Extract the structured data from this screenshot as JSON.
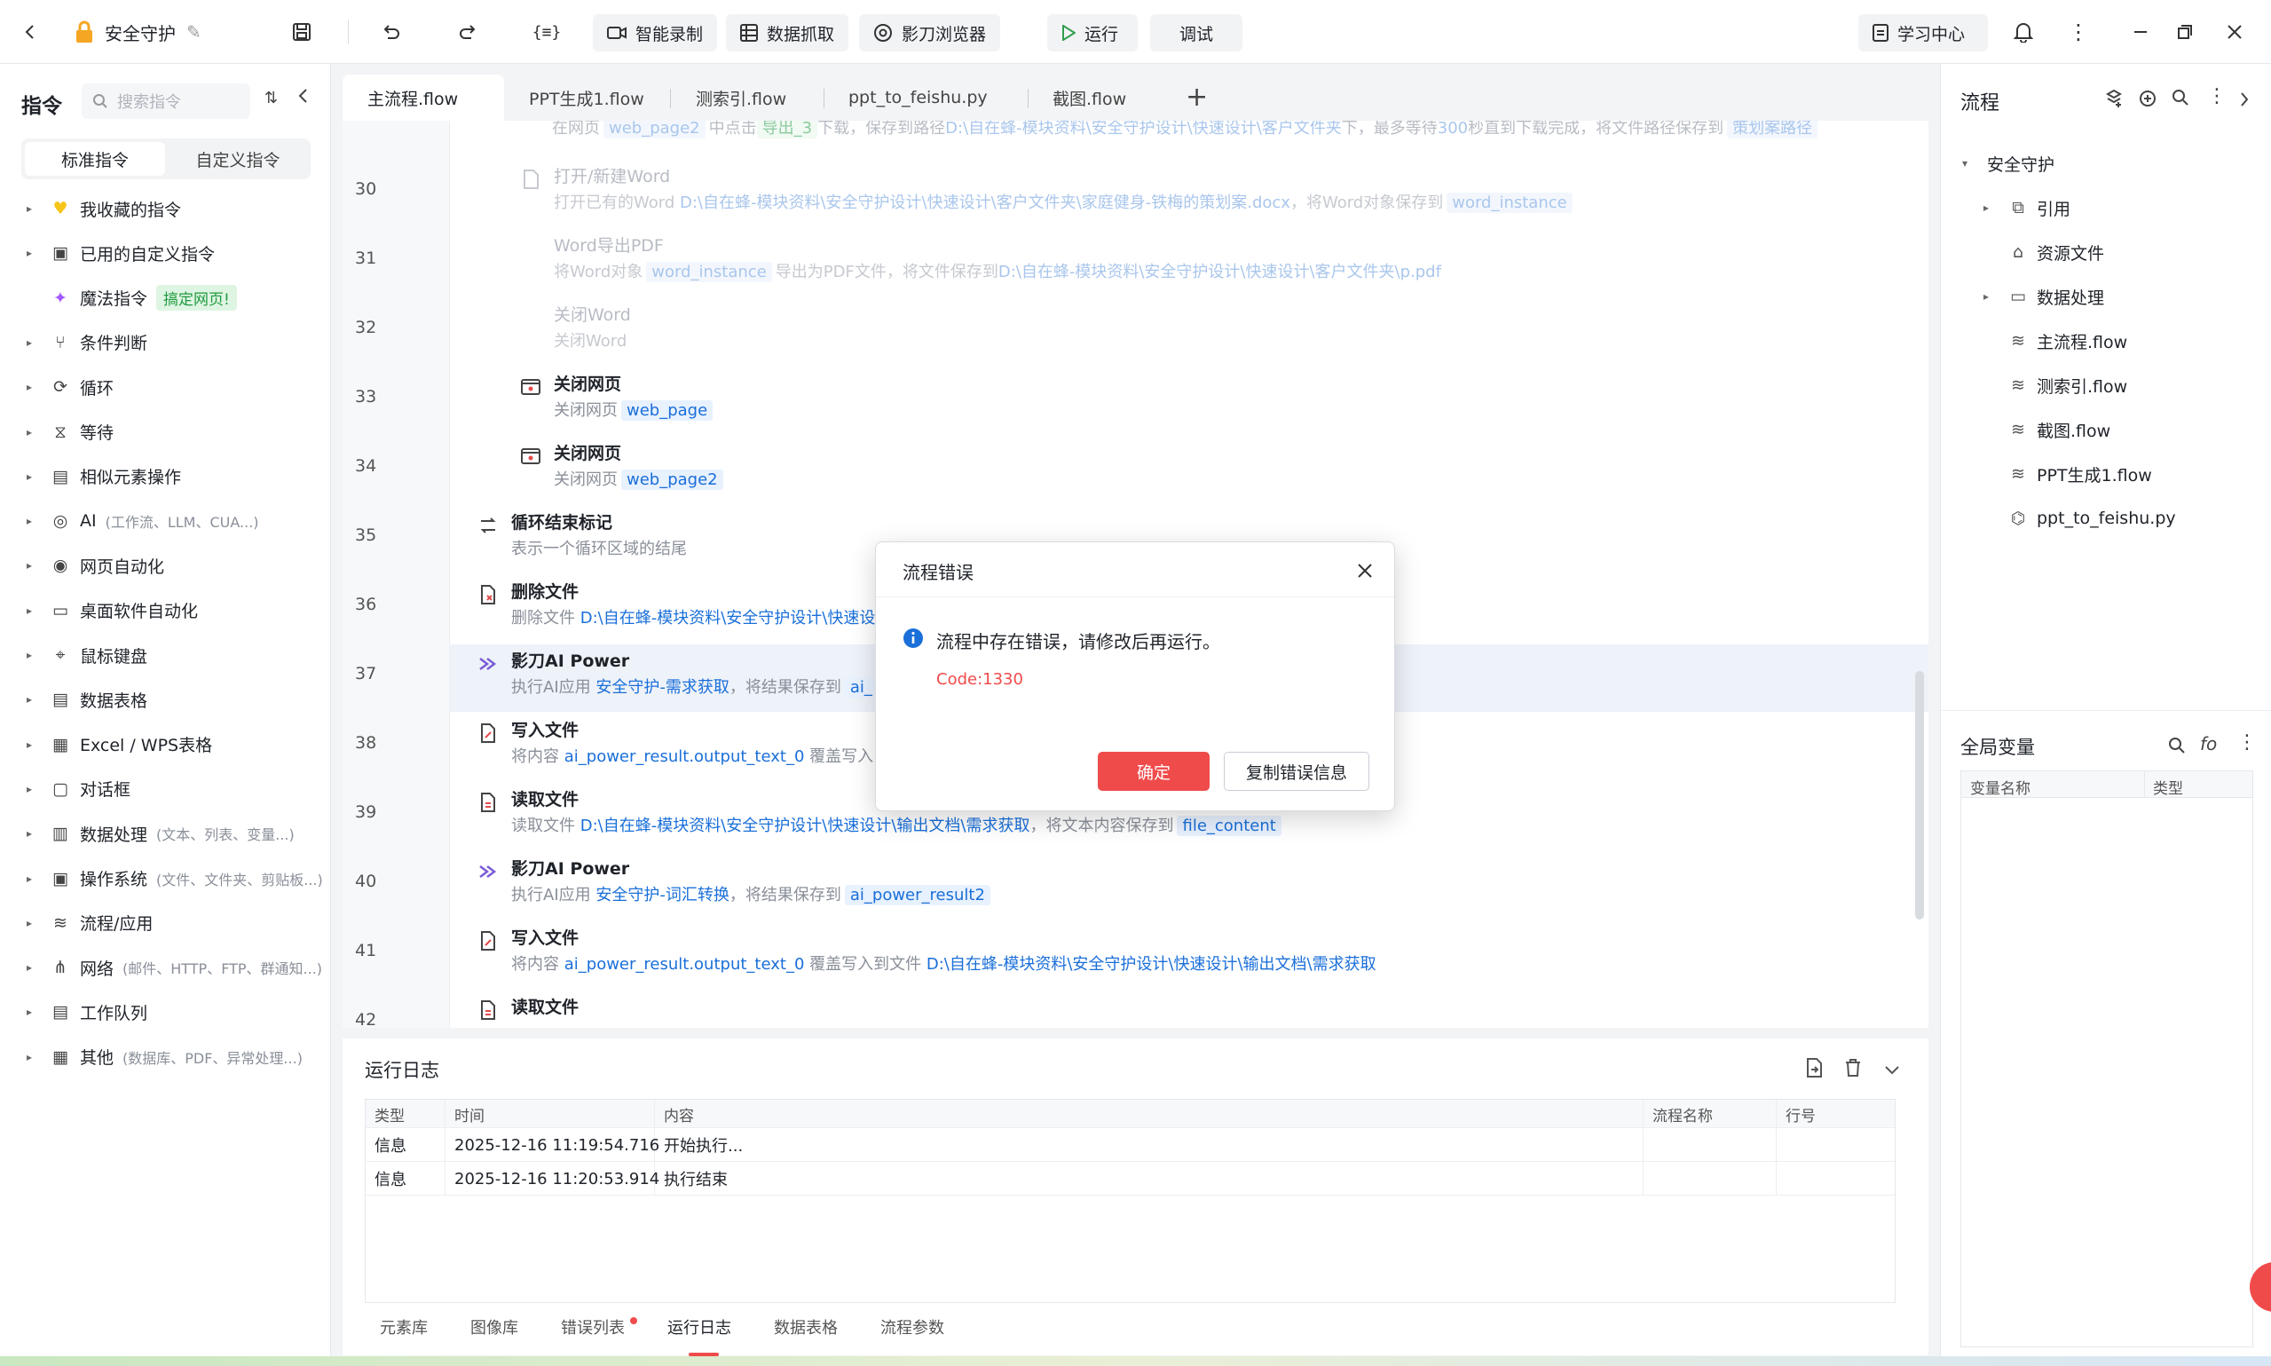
{
  "topbar": {
    "project_title": "安全守护",
    "buttons": [
      "智能录制",
      "数据抓取",
      "影刀浏览器"
    ],
    "run_label": "运行",
    "debug_label": "调试",
    "learn_center": "学习中心"
  },
  "left": {
    "title": "指令",
    "search_placeholder": "搜索指令",
    "tab_standard": "标准指令",
    "tab_custom": "自定义指令",
    "items": [
      {
        "label": "我收藏的指令",
        "sub": ""
      },
      {
        "label": "已用的自定义指令",
        "sub": ""
      },
      {
        "label": "魔法指令",
        "sub": "",
        "badge": "搞定网页!"
      },
      {
        "label": "条件判断",
        "sub": ""
      },
      {
        "label": "循环",
        "sub": ""
      },
      {
        "label": "等待",
        "sub": ""
      },
      {
        "label": "相似元素操作",
        "sub": ""
      },
      {
        "label": "AI",
        "sub": "(工作流、LLM、CUA...)"
      },
      {
        "label": "网页自动化",
        "sub": ""
      },
      {
        "label": "桌面软件自动化",
        "sub": ""
      },
      {
        "label": "鼠标键盘",
        "sub": ""
      },
      {
        "label": "数据表格",
        "sub": ""
      },
      {
        "label": "Excel / WPS表格",
        "sub": ""
      },
      {
        "label": "对话框",
        "sub": ""
      },
      {
        "label": "数据处理",
        "sub": "(文本、列表、变量...)"
      },
      {
        "label": "操作系统",
        "sub": "(文件、文件夹、剪贴板...)"
      },
      {
        "label": "流程/应用",
        "sub": ""
      },
      {
        "label": "网络",
        "sub": "(邮件、HTTP、FTP、群通知...)"
      },
      {
        "label": "工作队列",
        "sub": ""
      },
      {
        "label": "其他",
        "sub": "(数据库、PDF、异常处理...)"
      }
    ]
  },
  "tabs": [
    "主流程.flow",
    "PPT生成1.flow",
    "测索引.flow",
    "ppt_to_feishu.py",
    "截图.flow"
  ],
  "editor": {
    "top_partial": {
      "t1": "在网页",
      "v1": "web_page2",
      "t2": "中点击",
      "v2": "导出_3",
      "t3": "下载，保存到路径",
      "path": "D:\\自在蜂-模块资料\\安全守护设计\\快速设计\\客户文件夹",
      "t4": "下，最多等待",
      "num": "300",
      "t5": "秒直到下载完成，将文件路径保存到",
      "v3": "策划案路径"
    },
    "lines": [
      "30",
      "31",
      "32",
      "33",
      "34",
      "35",
      "36",
      "37",
      "38",
      "39",
      "40",
      "41",
      "42"
    ],
    "steps": {
      "s30": {
        "title": "打开/新建Word",
        "d1": "打开已有的Word",
        "path": "D:\\自在蜂-模块资料\\安全守护设计\\快速设计\\客户文件夹\\家庭健身-铁梅的策划案.docx",
        "d2": "，将Word对象保存到",
        "var": "word_instance"
      },
      "s31": {
        "title": "Word导出PDF",
        "d1": "将Word对象",
        "var": "word_instance",
        "d2": "导出为PDF文件，将文件保存到",
        "path": "D:\\自在蜂-模块资料\\安全守护设计\\快速设计\\客户文件夹\\p.pdf"
      },
      "s32": {
        "title": "关闭Word",
        "d1": "关闭Word"
      },
      "s33": {
        "title": "关闭网页",
        "d1": "关闭网页",
        "var": "web_page"
      },
      "s34": {
        "title": "关闭网页",
        "d1": "关闭网页",
        "var": "web_page2"
      },
      "s35": {
        "title": "循环结束标记",
        "d1": "表示一个循环区域的结尾"
      },
      "s36": {
        "title": "删除文件",
        "d1": "删除文件",
        "path": "D:\\自在蜂-模块资料\\安全守护设计\\快速设"
      },
      "s37": {
        "title": "影刀AI Power",
        "d1": "执行AI应用",
        "app": "安全守护-需求获取",
        "d2": "，将结果保存到",
        "var": "ai_"
      },
      "s38": {
        "title": "写入文件",
        "d1": "将内容",
        "var": "ai_power_result.output_text_0",
        "d2": "覆盖写入"
      },
      "s39": {
        "title": "读取文件",
        "d1": "读取文件",
        "path": "D:\\自在蜂-模块资料\\安全守护设计\\快速设计\\输出文档\\需求获取",
        "d2": "，将文本内容保存到",
        "var": "file_content"
      },
      "s40": {
        "title": "影刀AI Power",
        "d1": "执行AI应用",
        "app": "安全守护-词汇转换",
        "d2": "，将结果保存到",
        "var": "ai_power_result2"
      },
      "s41": {
        "title": "写入文件",
        "d1": "将内容",
        "var": "ai_power_result.output_text_0",
        "d2": "覆盖写入到文件",
        "path": "D:\\自在蜂-模块资料\\安全守护设计\\快速设计\\输出文档\\需求获取"
      },
      "s42": {
        "title": "读取文件"
      }
    }
  },
  "log": {
    "title": "运行日志",
    "headers": [
      "类型",
      "时间",
      "内容",
      "流程名称",
      "行号"
    ],
    "rows": [
      {
        "type": "信息",
        "time": "2025-12-16 11:19:54.716",
        "content": "开始执行..."
      },
      {
        "type": "信息",
        "time": "2025-12-16 11:20:53.914",
        "content": "执行结束"
      }
    ],
    "bottom_tabs": [
      "元素库",
      "图像库",
      "错误列表",
      "运行日志",
      "数据表格",
      "流程参数"
    ]
  },
  "right": {
    "title": "流程",
    "tree": [
      {
        "label": "安全守护",
        "level": 0,
        "caret": "down",
        "icon": "none"
      },
      {
        "label": "引用",
        "level": 1,
        "caret": "right",
        "icon": "copy-icon"
      },
      {
        "label": "资源文件",
        "level": 1,
        "caret": "",
        "icon": "folder-open-icon"
      },
      {
        "label": "数据处理",
        "level": 1,
        "caret": "right",
        "icon": "folder-icon"
      },
      {
        "label": "主流程.flow",
        "level": 1,
        "caret": "",
        "icon": "layers-icon"
      },
      {
        "label": "测索引.flow",
        "level": 1,
        "caret": "",
        "icon": "layers-icon"
      },
      {
        "label": "截图.flow",
        "level": 1,
        "caret": "",
        "icon": "layers-icon"
      },
      {
        "label": "PPT生成1.flow",
        "level": 1,
        "caret": "",
        "icon": "layers-icon"
      },
      {
        "label": "ppt_to_feishu.py",
        "level": 1,
        "caret": "",
        "icon": "python-icon"
      }
    ],
    "globals_title": "全局变量",
    "globals_headers": [
      "变量名称",
      "类型"
    ]
  },
  "modal": {
    "title": "流程错误",
    "message": "流程中存在错误，请修改后再运行。",
    "code": "Code:1330",
    "ok": "确定",
    "copy": "复制错误信息"
  },
  "colors": {
    "accent": "#1a6fd9",
    "danger": "#f04b4b",
    "ok_button": "#f04b4b"
  }
}
